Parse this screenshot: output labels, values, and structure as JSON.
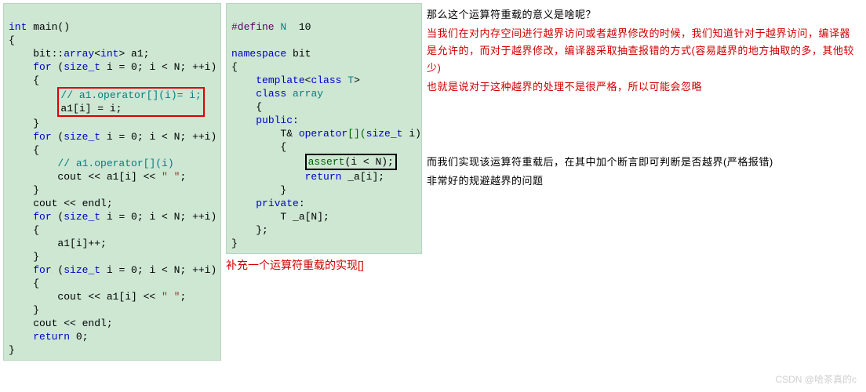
{
  "code1": {
    "l01a": "int",
    "l01b": " main()",
    "l02": "{",
    "l03a": "    bit::",
    "l03b": "array",
    "l03c": "<",
    "l03d": "int",
    "l03e": "> a1;",
    "l04a": "    ",
    "l04b": "for",
    "l04c": " (",
    "l04d": "size_t",
    "l04e": " i = 0; i < N; ++i)",
    "l05": "    {",
    "l06a": "        ",
    "l06b": "// a1.operator[](i)= i;",
    "l07": "        a1[i] = i;",
    "l08": "    }",
    "l09a": "    ",
    "l09b": "for",
    "l09c": " (",
    "l09d": "size_t",
    "l09e": " i = 0; i < N; ++i)",
    "l10": "    {",
    "l11a": "        ",
    "l11b": "// a1.operator[](i)",
    "l12a": "        cout << a1[i] << ",
    "l12b": "\" \"",
    "l12c": ";",
    "l13": "    }",
    "l14": "    cout << endl;",
    "l15a": "    ",
    "l15b": "for",
    "l15c": " (",
    "l15d": "size_t",
    "l15e": " i = 0; i < N; ++i)",
    "l16": "    {",
    "l17": "        a1[i]++;",
    "l18": "    }",
    "l19a": "    ",
    "l19b": "for",
    "l19c": " (",
    "l19d": "size_t",
    "l19e": " i = 0; i < N; ++i)",
    "l20": "    {",
    "l21a": "        cout << a1[i] << ",
    "l21b": "\" \"",
    "l21c": ";",
    "l22": "    }",
    "l23": "    cout << endl;",
    "l24a": "    ",
    "l24b": "return",
    "l24c": " 0;",
    "l25": "}"
  },
  "code2": {
    "l01a": "#define",
    "l01b": " N",
    "l01c": "  10",
    "blank": "",
    "l02a": "namespace",
    "l02b": " bit",
    "l03": "{",
    "l04a": "    ",
    "l04b": "template",
    "l04c": "<",
    "l04d": "class",
    "l04e": " T",
    "l04f": ">",
    "l05a": "    ",
    "l05b": "class",
    "l05c": " array",
    "l06": "    {",
    "l07a": "    ",
    "l07b": "public",
    "l07c": ":",
    "l08a": "        T& ",
    "l08b": "operator",
    "l08c": "[](",
    "l08d": "size_t",
    "l08e": " i)",
    "l09": "        {",
    "l10a": "            ",
    "l10b": "assert",
    "l10c": "(i < N);",
    "l11a": "            ",
    "l11b": "return",
    "l11c": " _a[i];",
    "l12": "        }",
    "l13a": "    ",
    "l13b": "private",
    "l13c": ":",
    "l14": "        T _a[N];",
    "l15": "    };",
    "l16": "}"
  },
  "caption": "补充一个运算符重载的实现[]",
  "notes": {
    "p1": "那么这个运算符重载的意义是啥呢？",
    "p2": "当我们在对内存空间进行越界访问或者越界修改的时候，我们知道针对于越界访问，编译器是允许的，而对于越界修改，编译器采取抽查报错的方式(容易越界的地方抽取的多，其他较少)",
    "p3": "也就是说对于这种越界的处理不是很严格，所以可能会忽略",
    "p4": "而我们实现该运算符重载后，在其中加个断言即可判断是否越界(严格报错)",
    "p5": "非常好的规避越界的问题"
  },
  "watermark": "CSDN @哈茶真的c"
}
